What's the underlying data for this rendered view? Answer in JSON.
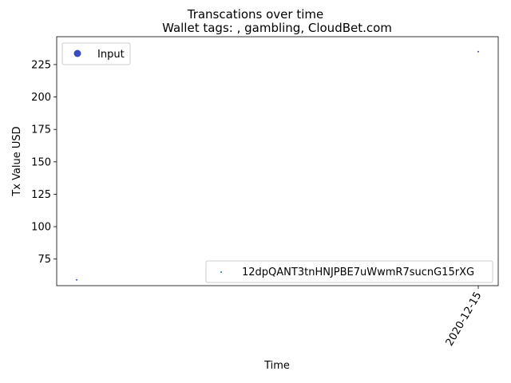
{
  "chart_data": {
    "type": "scatter",
    "title": "Transcations over time",
    "subtitle": "Wallet tags: , gambling, CloudBet.com",
    "xlabel": "Time",
    "ylabel": "Tx Value USD",
    "x_tick_labels": [
      "2020-12-15"
    ],
    "y_ticks": [
      75,
      100,
      125,
      150,
      175,
      200,
      225
    ],
    "ylim": [
      54.5,
      246.5
    ],
    "grid": false,
    "series": [
      {
        "name": "Input",
        "color": "#3b4cc0",
        "points": [
          {
            "x": "2020-12-14",
            "y": 59
          },
          {
            "x": "2020-12-15",
            "y": 235
          }
        ]
      }
    ],
    "legends": [
      {
        "placement": "top-left",
        "entries": [
          {
            "label": "Input",
            "color": "#3b4cc0",
            "marker": "circle"
          }
        ]
      },
      {
        "placement": "bottom-right",
        "entries": [
          {
            "label": "12dpQANT3tnHNJPBE7uWwmR7sucnG15rXG",
            "color": "#1f77b4",
            "marker": "dot"
          }
        ]
      }
    ]
  }
}
